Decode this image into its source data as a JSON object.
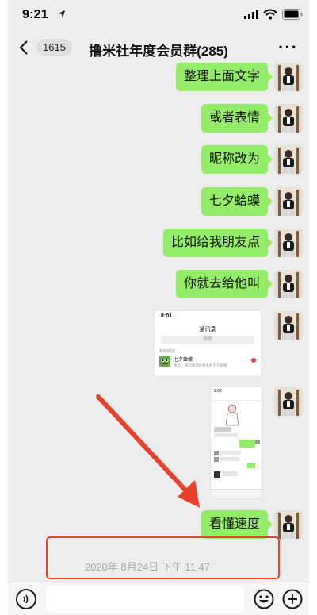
{
  "status_bar": {
    "time": "9:21"
  },
  "nav": {
    "back_count": "1615",
    "title": "撸米社年度会员群(285)",
    "more": "···"
  },
  "messages": [
    {
      "text": "整理上面文字"
    },
    {
      "text": "或者表情"
    },
    {
      "text": "昵称改为"
    },
    {
      "text": "七夕蛤蟆"
    },
    {
      "text": "比如给我朋友点"
    },
    {
      "text": "你就去给他叫"
    },
    {
      "text": "看懂速度"
    }
  ],
  "screenshot1": {
    "time": "8:01",
    "title": "通讯录",
    "search_placeholder": "搜索",
    "section": "新的朋友",
    "contact_name": "七夕蛤蟆",
    "contact_msg": "我是，朋友邀请给我发的七夕蛤蟆"
  },
  "screenshot2": {
    "time": "9:02"
  },
  "timestamp": "2020年 8月24日 下午 11:47",
  "colors": {
    "bubble": "#95ec69",
    "background": "#ededed",
    "arrow": "#e8412c",
    "timestamp": "#a8a8a8"
  },
  "icons": {
    "voice": "voice-icon",
    "emoji": "emoji-icon",
    "plus": "plus-icon",
    "back": "chevron-left-icon",
    "wifi": "wifi-icon",
    "signal": "signal-icon",
    "battery": "battery-icon"
  }
}
